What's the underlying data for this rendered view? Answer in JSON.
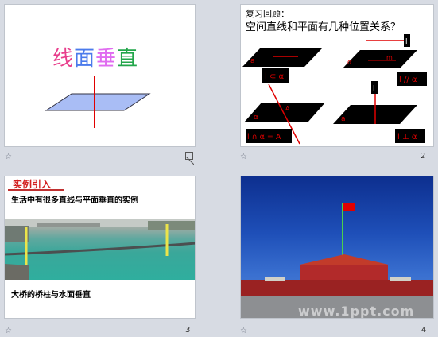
{
  "slides": [
    {
      "title_chars": [
        "线",
        "面",
        "垂",
        "直"
      ],
      "title_colors": [
        "#e83e8c",
        "#4b7bec",
        "#e06cf0",
        "#22a64a"
      ],
      "number": ""
    },
    {
      "heading_line1": "复习回顾：",
      "heading_line2": "空间直线和平面有几种位置关系？",
      "labels": {
        "a1": "a",
        "a2": "α",
        "m": "m",
        "a3": "α",
        "a4": "a",
        "l1": "l",
        "l2": "l",
        "A": "A",
        "rel1": "l ⊂ α",
        "rel2": "l // α",
        "rel3": "l ∩ α = A",
        "rel4": "l ⊥ α"
      },
      "number": "2"
    },
    {
      "heading": "实例引入",
      "subtitle": "生活中有很多直线与平面垂直的实例",
      "caption": "大桥的桥柱与水面垂直",
      "number": "3"
    },
    {
      "watermark": "www.1ppt.com",
      "number": "4"
    }
  ],
  "colors": {
    "accent_red": "#e00000",
    "plane_fill": "#a9bdf5"
  }
}
